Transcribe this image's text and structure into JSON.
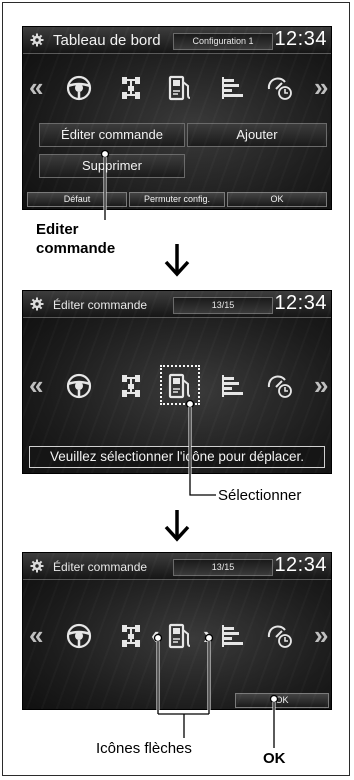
{
  "panel1": {
    "title": "Tableau de bord",
    "config_label": "Configuration 1",
    "clock": "12:34",
    "buttons": {
      "edit": "Éditer commande",
      "add": "Ajouter",
      "delete": "Supprimer"
    },
    "bottom": {
      "default": "Défaut",
      "swap": "Permuter config.",
      "ok": "OK"
    }
  },
  "callout1": {
    "line1": "Editer",
    "line2": "commande"
  },
  "panel2": {
    "title": "Éditer commande",
    "counter": "13/15",
    "clock": "12:34",
    "message": "Veuillez sélectionner l'icône pour déplacer."
  },
  "callout2": {
    "label": "Sélectionner"
  },
  "panel3": {
    "title": "Éditer commande",
    "counter": "13/15",
    "clock": "12:34",
    "ok": "OK"
  },
  "callout3": {
    "arrows_label": "Icônes flèches",
    "ok_label": "OK"
  },
  "icons": [
    "steering-icon",
    "drivetrain-icon",
    "fuel-pump-icon",
    "bar-graph-icon",
    "speed-clock-icon"
  ],
  "arrows": {
    "left": "«",
    "right": "»",
    "move_left": "‹",
    "move_right": "›"
  },
  "colors": {
    "screen_bg": "#1c1c1c",
    "text": "#f2f2f2",
    "callout": "#000000"
  }
}
